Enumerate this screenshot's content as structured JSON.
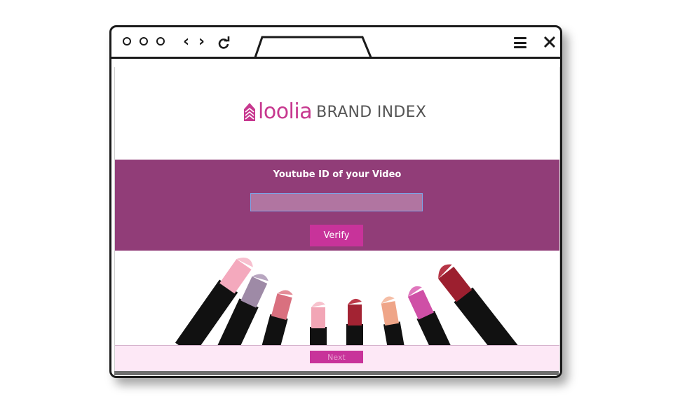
{
  "brand": {
    "name": "loolia",
    "subtitle": "BRAND INDEX",
    "accent_color": "#c7388f",
    "band_color": "#913d78"
  },
  "form": {
    "label": "Youtube ID of your Video",
    "input_value": "",
    "verify_label": "Verify"
  },
  "footer": {
    "next_label": "Next"
  },
  "icons": {
    "window_controls": [
      "circle-icon",
      "circle-icon",
      "circle-icon"
    ],
    "nav": [
      "back-icon",
      "forward-icon",
      "reload-icon"
    ],
    "right": [
      "menu-icon",
      "close-icon"
    ]
  },
  "lipstick_colors": [
    "#f4a9bd",
    "#9e8aa6",
    "#d9707f",
    "#f2a6b6",
    "#a32333",
    "#efa588",
    "#cf4fa6",
    "#9c1f2f"
  ]
}
